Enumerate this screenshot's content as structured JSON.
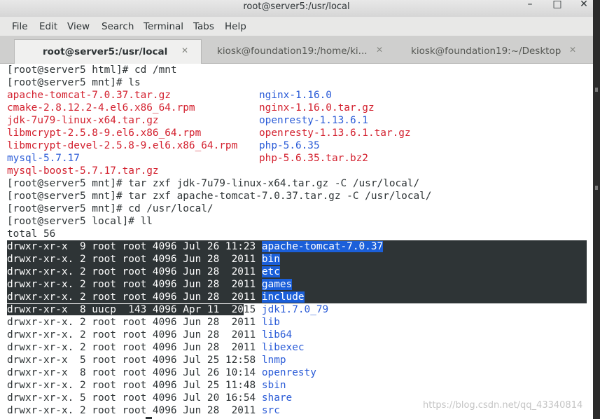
{
  "window": {
    "title": "root@server5:/usr/local",
    "minimize_glyph": "–",
    "maximize_glyph": "□",
    "close_glyph": "✕"
  },
  "menu": [
    "File",
    "Edit",
    "View",
    "Search",
    "Terminal",
    "Tabs",
    "Help"
  ],
  "tabs": [
    {
      "label": "root@server5:/usr/local",
      "close": "✕"
    },
    {
      "label": "kiosk@foundation19:/home/ki...",
      "close": "✕"
    },
    {
      "label": "kiosk@foundation19:~/Desktop",
      "close": "✕"
    }
  ],
  "terminal": {
    "colors": {
      "background": "#ffffff",
      "text": "#2e3436",
      "archive": "#d3202e",
      "directory": "#2a5bd7",
      "selection": "#2e3436"
    },
    "cmd1": "[root@server5 html]# cd /mnt",
    "cmd2": "[root@server5 mnt]# ls",
    "ls_left": [
      "apache-tomcat-7.0.37.tar.gz",
      "cmake-2.8.12.2-4.el6.x86_64.rpm",
      "jdk-7u79-linux-x64.tar.gz",
      "libmcrypt-2.5.8-9.el6.x86_64.rpm",
      "libmcrypt-devel-2.5.8-9.el6.x86_64.rpm",
      "mysql-5.7.17",
      "mysql-boost-5.7.17.tar.gz"
    ],
    "ls_right": [
      "nginx-1.16.0",
      "nginx-1.16.0.tar.gz",
      "openresty-1.13.6.1",
      "openresty-1.13.6.1.tar.gz",
      "php-5.6.35",
      "php-5.6.35.tar.bz2"
    ],
    "cmd3": "[root@server5 mnt]# tar zxf jdk-7u79-linux-x64.tar.gz -C /usr/local/",
    "cmd4": "[root@server5 mnt]# tar zxf apache-tomcat-7.0.37.tar.gz -C /usr/local/",
    "cmd5": "[root@server5 mnt]# cd /usr/local/",
    "cmd6": "[root@server5 local]# ll",
    "total": "total 56",
    "listing": [
      {
        "meta": "drwxr-xr-x  9 root root 4096 Jul 26 11:23 ",
        "name": "apache-tomcat-7.0.37"
      },
      {
        "meta": "drwxr-xr-x. 2 root root 4096 Jun 28  2011 ",
        "name": "bin"
      },
      {
        "meta": "drwxr-xr-x. 2 root root 4096 Jun 28  2011 ",
        "name": "etc"
      },
      {
        "meta": "drwxr-xr-x. 2 root root 4096 Jun 28  2011 ",
        "name": "games"
      },
      {
        "meta": "drwxr-xr-x. 2 root root 4096 Jun 28  2011 ",
        "name": "include"
      },
      {
        "meta_sel": "drwxr-xr-x  8 uucp  143 4096 Apr 11  20",
        "meta_rest": "15 ",
        "name": "jdk1.7.0_79"
      },
      {
        "meta": "drwxr-xr-x. 2 root root 4096 Jun 28  2011 ",
        "name": "lib"
      },
      {
        "meta": "drwxr-xr-x. 2 root root 4096 Jun 28  2011 ",
        "name": "lib64"
      },
      {
        "meta": "drwxr-xr-x. 2 root root 4096 Jun 28  2011 ",
        "name": "libexec"
      },
      {
        "meta": "drwxr-xr-x  5 root root 4096 Jul 25 12:58 ",
        "name": "lnmp"
      },
      {
        "meta": "drwxr-xr-x  8 root root 4096 Jul 26 10:14 ",
        "name": "openresty"
      },
      {
        "meta": "drwxr-xr-x. 2 root root 4096 Jul 25 11:48 ",
        "name": "sbin"
      },
      {
        "meta": "drwxr-xr-x. 5 root root 4096 Jul 20 16:54 ",
        "name": "share"
      },
      {
        "meta": "drwxr-xr-x. 2 root root 4096 Jun 28  2011 ",
        "name": "src"
      }
    ]
  },
  "watermark": "https://blog.csdn.net/qq_43340814"
}
